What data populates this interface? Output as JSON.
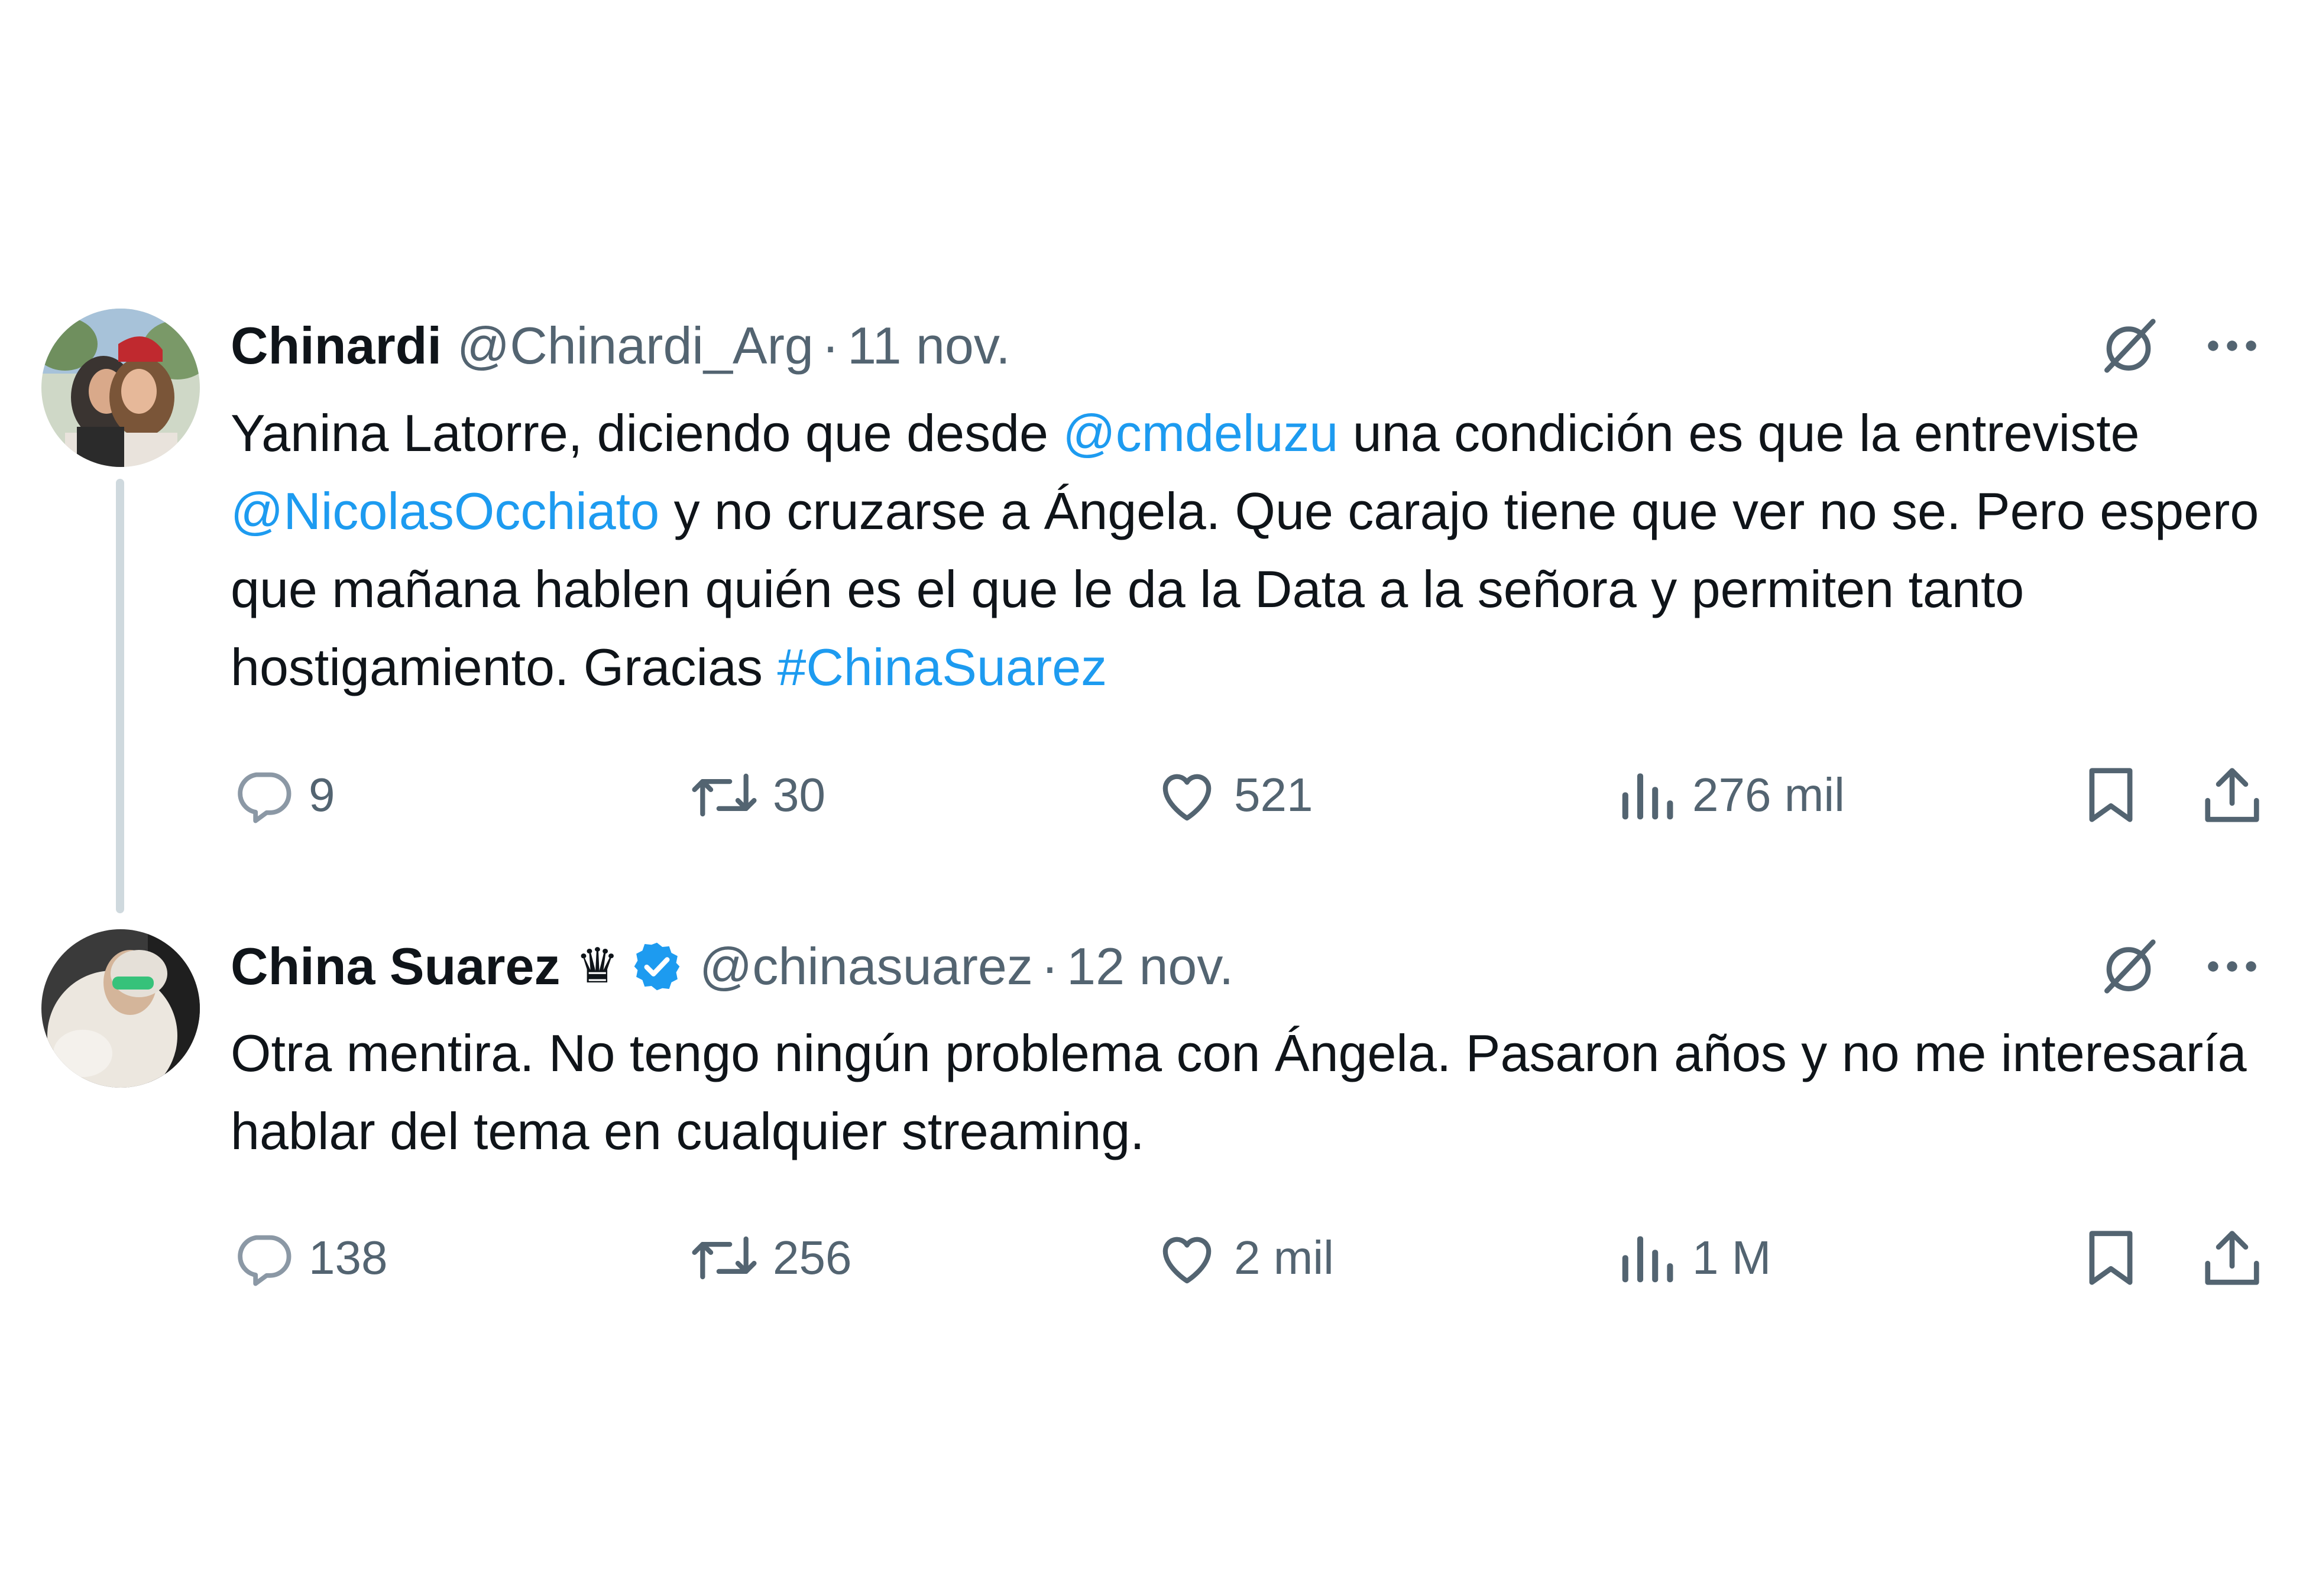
{
  "colors": {
    "text": "#0f1419",
    "secondary": "#536471",
    "link": "#1d9bf0",
    "thread_line": "#cfd9de",
    "verified": "#1d9bf0"
  },
  "tweets": [
    {
      "display_name": "Chinardi",
      "handle": "@Chinardi_Arg",
      "separator": "·",
      "date": "11 nov.",
      "text_parts": [
        "Yanina Latorre, diciendo que desde ",
        "@cmdeluzu",
        " una condición es que la entreviste ",
        "@NicolasOcchiato",
        " y no cruzarse a Ángela. Que carajo tiene que ver no se. Pero espero que mañana hablen quién es el que le da la Data a la señora y permiten tanto hostigamiento. Gracias ",
        "#ChinaSuarez"
      ],
      "stats": {
        "replies": "9",
        "reposts": "30",
        "likes": "521",
        "views": "276 mil"
      }
    },
    {
      "display_name": "China Suarez",
      "badge_glyph": "♛",
      "verified": true,
      "handle": "@chinasuarez",
      "separator": "·",
      "date": "12 nov.",
      "text": "Otra mentira. No tengo ningún problema con Ángela. Pasaron años y no me interesaría hablar del tema en cualquier streaming.",
      "stats": {
        "replies": "138",
        "reposts": "256",
        "likes": "2 mil",
        "views": "1 M"
      }
    }
  ],
  "icons": {
    "reply": "reply-icon",
    "repost": "repost-icon",
    "like": "heart-icon",
    "views": "views-chart-icon",
    "bookmark": "bookmark-icon",
    "share": "share-icon",
    "grok": "grok-icon",
    "more": "more-icon"
  }
}
